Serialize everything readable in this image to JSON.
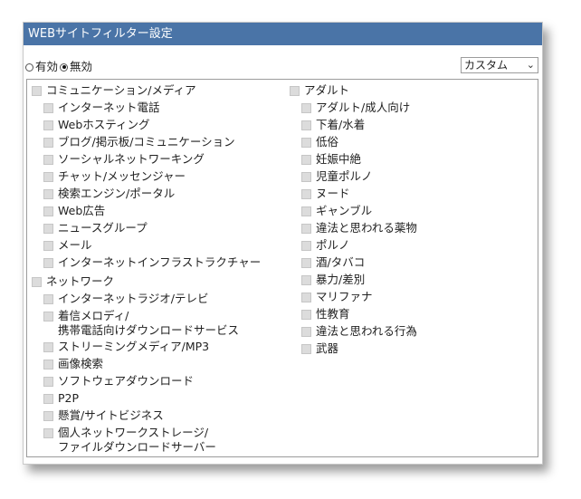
{
  "title": "WEBサイトフィルター設定",
  "mode": {
    "options": [
      {
        "label": "有効",
        "checked": false
      },
      {
        "label": "無効",
        "checked": true
      }
    ]
  },
  "preset_select": {
    "value": "カスタム"
  },
  "categories": {
    "left": [
      {
        "label": "コミュニケーション/メディア",
        "children": [
          "インターネット電話",
          "Webホスティング",
          "ブログ/掲示板/コミュニケーション",
          "ソーシャルネットワーキング",
          "チャット/メッセンジャー",
          "検索エンジン/ポータル",
          "Web広告",
          "ニュースグループ",
          "メール",
          "インターネットインフラストラクチャー"
        ]
      },
      {
        "label": "ネットワーク",
        "children": [
          "インターネットラジオ/テレビ",
          "着信メロディ/\n携帯電話向けダウンロードサービス",
          "ストリーミングメディア/MP3",
          "画像検索",
          "ソフトウェアダウンロード",
          "P2P",
          "懸賞/サイトビジネス",
          "個人ネットワークストレージ/\nファイルダウンロードサーバー"
        ]
      }
    ],
    "right": [
      {
        "label": "アダルト",
        "children": [
          "アダルト/成人向け",
          "下着/水着",
          "低俗",
          "妊娠中絶",
          "児童ポルノ",
          "ヌード",
          "ギャンブル",
          "違法と思われる薬物",
          "ポルノ",
          "酒/タバコ",
          "暴力/差別",
          "マリファナ",
          "性教育",
          "違法と思われる行為",
          "武器"
        ]
      }
    ]
  }
}
